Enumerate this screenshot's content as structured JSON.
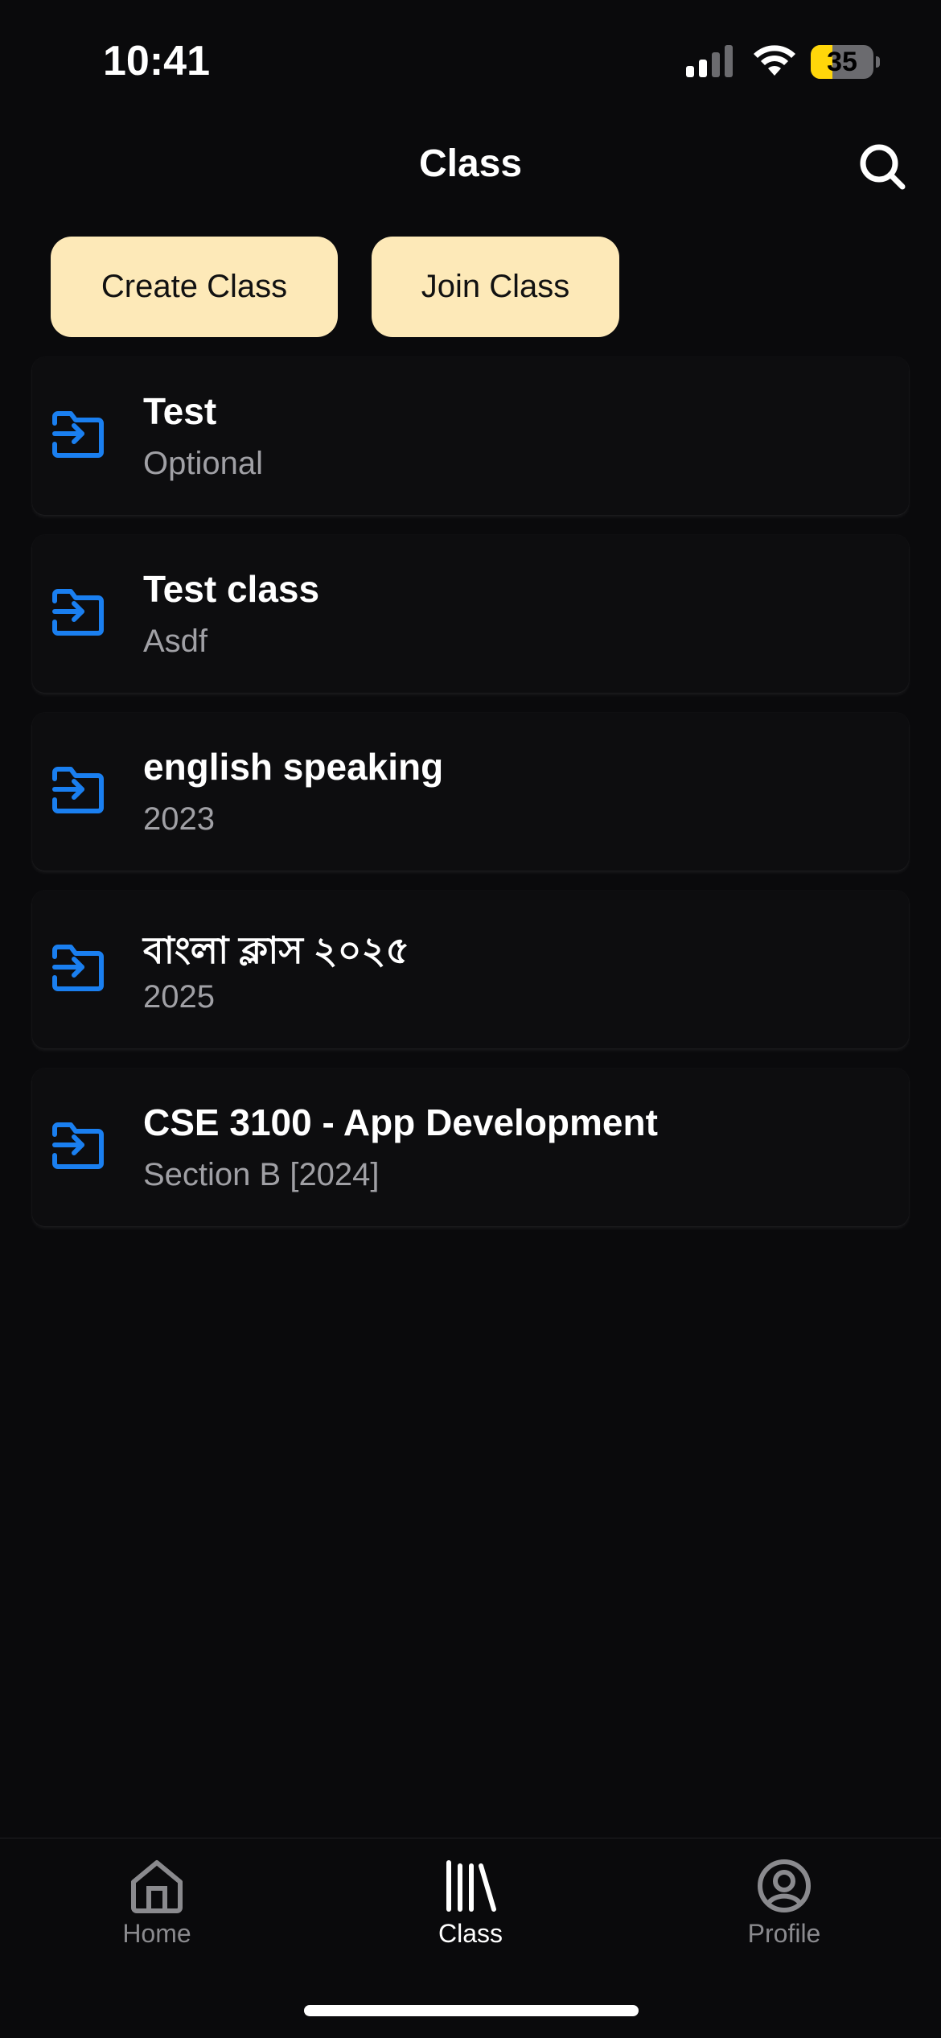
{
  "status_bar": {
    "time": "10:41",
    "battery_level": "35",
    "battery_fraction": 0.35,
    "icons": [
      "signal-icon",
      "wifi-icon",
      "battery-icon"
    ]
  },
  "header": {
    "title": "Class",
    "search_icon": "search-icon"
  },
  "actions": {
    "create_label": "Create Class",
    "join_label": "Join Class",
    "button_color": "#fde9b8"
  },
  "classes": [
    {
      "title": "Test",
      "subtitle": "Optional",
      "icon": "folder-enter-icon"
    },
    {
      "title": "Test class",
      "subtitle": "Asdf",
      "icon": "folder-enter-icon"
    },
    {
      "title": "english speaking",
      "subtitle": "2023",
      "icon": "folder-enter-icon"
    },
    {
      "title": "বাংলা ক্লাস ২০২৫",
      "subtitle": "2025",
      "icon": "folder-enter-icon"
    },
    {
      "title": "CSE 3100 - App Development",
      "subtitle": "Section B [2024]",
      "icon": "folder-enter-icon"
    }
  ],
  "tab_bar": {
    "items": [
      {
        "label": "Home",
        "icon": "home-icon",
        "active": false
      },
      {
        "label": "Class",
        "icon": "library-icon",
        "active": true
      },
      {
        "label": "Profile",
        "icon": "profile-icon",
        "active": false
      }
    ]
  },
  "colors": {
    "background": "#0a0a0c",
    "accent": "#1a7ff0",
    "subtitle": "#a0a0a5"
  }
}
